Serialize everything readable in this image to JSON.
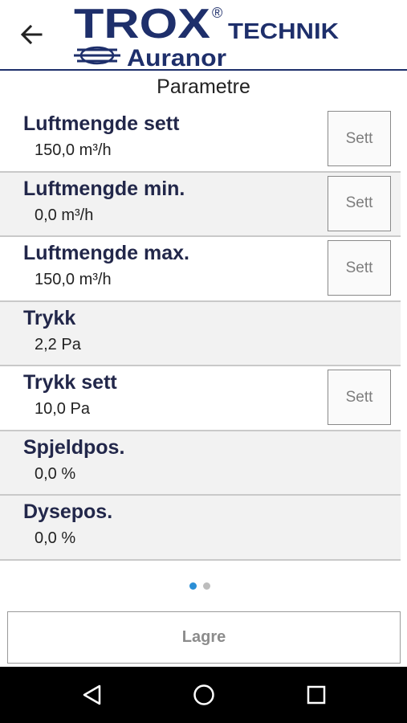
{
  "header": {
    "brand_main": "TROX",
    "brand_registered": "®",
    "brand_technik": "TECHNIK",
    "brand_sub": "Auranor",
    "brand_color": "#1e2f6b"
  },
  "page": {
    "title": "Parametre"
  },
  "params": [
    {
      "name": "Luftmengde sett",
      "value": "150,0 m³/h",
      "has_button": true,
      "button": "Sett"
    },
    {
      "name": "Luftmengde min.",
      "value": "0,0 m³/h",
      "has_button": true,
      "button": "Sett"
    },
    {
      "name": "Luftmengde max.",
      "value": "150,0 m³/h",
      "has_button": true,
      "button": "Sett"
    },
    {
      "name": "Trykk",
      "value": "2,2 Pa",
      "has_button": false
    },
    {
      "name": "Trykk sett",
      "value": "10,0 Pa",
      "has_button": true,
      "button": "Sett"
    },
    {
      "name": "Spjeldpos.",
      "value": "0,0 %",
      "has_button": false
    },
    {
      "name": "Dysepos.",
      "value": "0,0 %",
      "has_button": false
    }
  ],
  "pager": {
    "active_color": "#2b8fd6",
    "inactive_color": "#bdbdbd",
    "pages": 2,
    "active_index": 0
  },
  "footer": {
    "save_label": "Lagre"
  },
  "system_nav": {
    "icons": [
      "back-triangle-icon",
      "home-circle-icon",
      "recents-square-icon"
    ]
  }
}
